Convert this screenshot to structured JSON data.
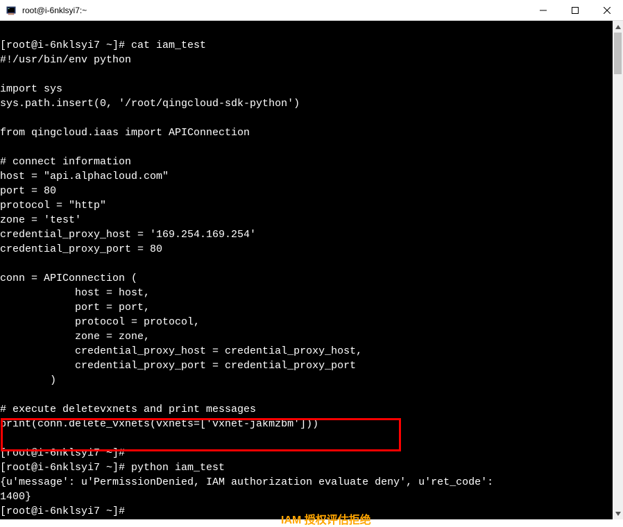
{
  "window": {
    "title": "root@i-6nklsyi7:~"
  },
  "terminal": {
    "lines": [
      "",
      "[root@i-6nklsyi7 ~]# cat iam_test",
      "#!/usr/bin/env python",
      "",
      "import sys",
      "sys.path.insert(0, '/root/qingcloud-sdk-python')",
      "",
      "from qingcloud.iaas import APIConnection",
      "",
      "# connect information",
      "host = \"api.alphacloud.com\"",
      "port = 80",
      "protocol = \"http\"",
      "zone = 'test'",
      "credential_proxy_host = '169.254.169.254'",
      "credential_proxy_port = 80",
      "",
      "conn = APIConnection (",
      "            host = host,",
      "            port = port,",
      "            protocol = protocol,",
      "            zone = zone,",
      "            credential_proxy_host = credential_proxy_host,",
      "            credential_proxy_port = credential_proxy_port",
      "        )",
      "",
      "# execute deletevxnets and print messages",
      "print(conn.delete_vxnets(vxnets=['vxnet-jakmzbm']))",
      "",
      "[root@i-6nklsyi7 ~]#",
      "[root@i-6nklsyi7 ~]# python iam_test",
      "{u'message': u'PermissionDenied, IAM authorization evaluate deny', u'ret_code':",
      "1400}",
      "[root@i-6nklsyi7 ~]#"
    ]
  },
  "annotation": {
    "text": "IAM 授权评估拒绝"
  }
}
